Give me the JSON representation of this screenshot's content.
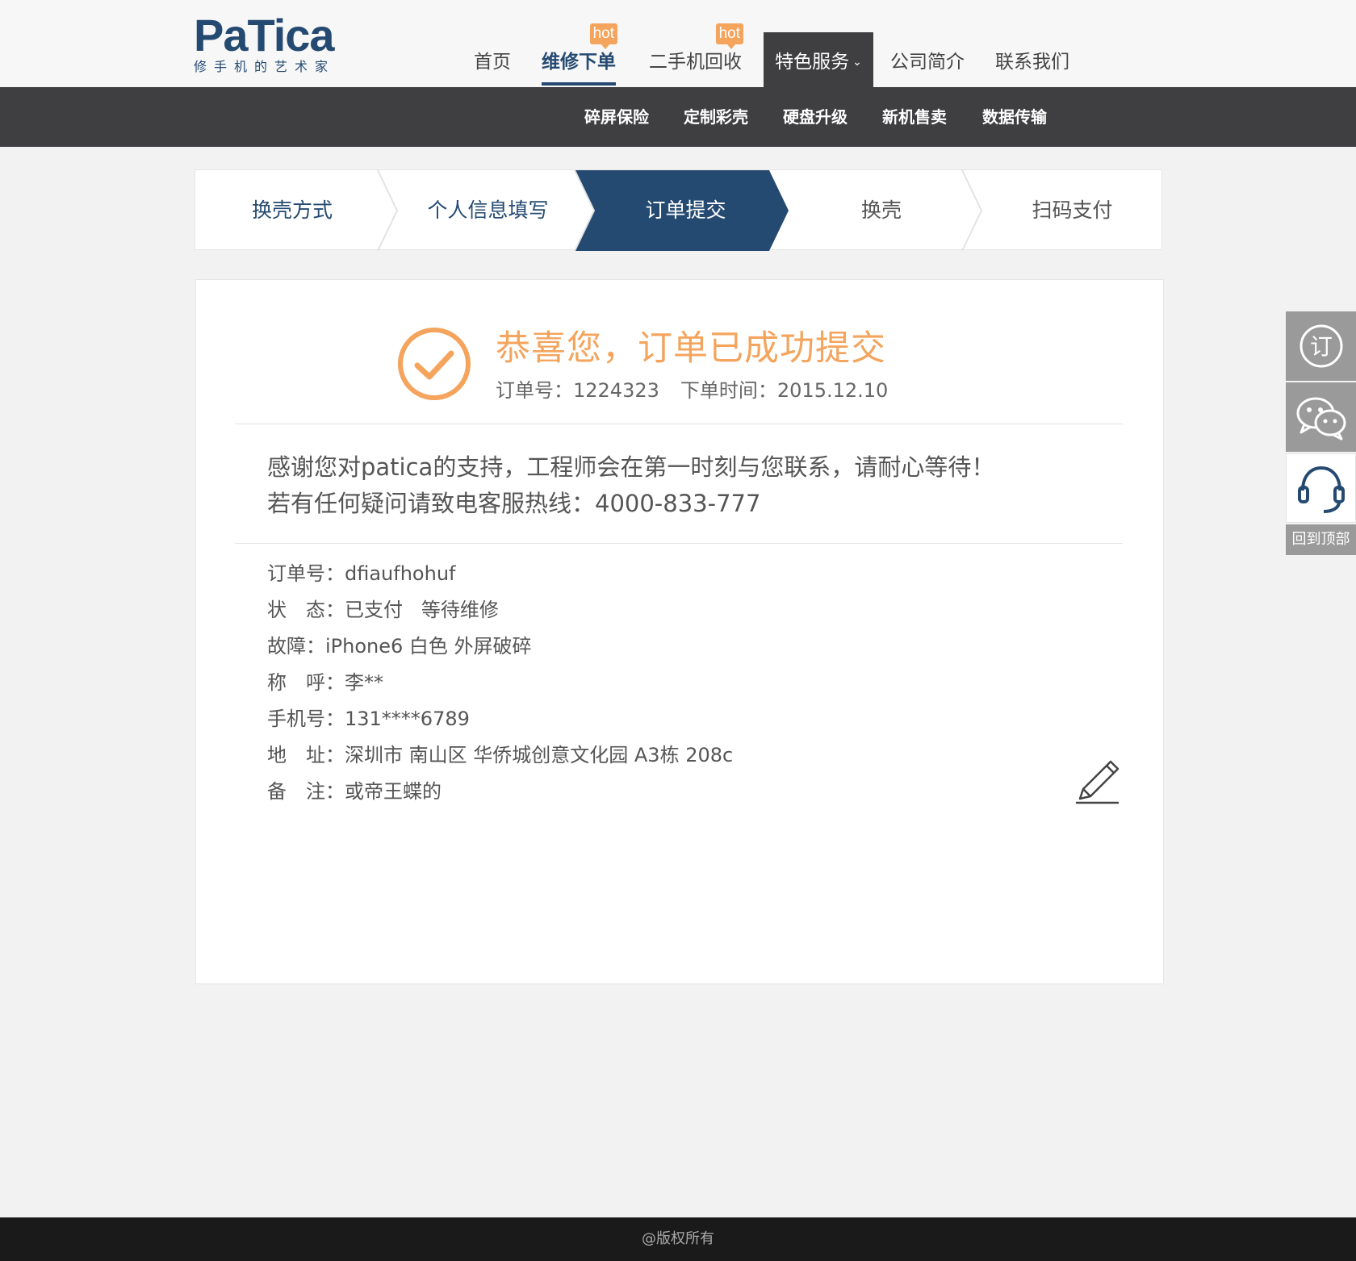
{
  "brand": {
    "name": "PaTica",
    "tagline": "修手机的艺术家"
  },
  "nav": {
    "items": [
      {
        "label": "首页"
      },
      {
        "label": "维修下单",
        "badge": "hot"
      },
      {
        "label": "二手机回收",
        "badge": "hot"
      },
      {
        "label": "特色服务"
      },
      {
        "label": "公司简介"
      },
      {
        "label": "联系我们"
      }
    ],
    "active": "维修下单"
  },
  "subnav": {
    "items": [
      "碎屏保险",
      "定制彩壳",
      "硬盘升级",
      "新机售卖",
      "数据传输"
    ]
  },
  "steps": {
    "items": [
      "换壳方式",
      "个人信息填写",
      "订单提交",
      "换壳",
      "扫码支付"
    ],
    "current": "订单提交"
  },
  "success": {
    "title": "恭喜您，订单已成功提交",
    "order_no": "订单号：1224323",
    "order_time": "下单时间：2015.12.10"
  },
  "message": {
    "line1": "感谢您对patica的支持，工程师会在第一时刻与您联系，请耐心等待！",
    "line2": "若有任何疑问请致电客服热线：4000-833-777"
  },
  "details": [
    {
      "label": "订单号：",
      "value": "dfiaufhohuf"
    },
    {
      "label": "状　态：",
      "value": "已支付   等待维修"
    },
    {
      "label": "故障：",
      "value": "iPhone6 白色 外屏破碎"
    },
    {
      "label": "称　呼：",
      "value": "李**"
    },
    {
      "label": "手机号：",
      "value": "131****6789"
    },
    {
      "label": "地　址：",
      "value": "深圳市 南山区 华侨城创意文化园 A3栋 208c"
    },
    {
      "label": "备　注：",
      "value": "或帝王蝶的"
    }
  ],
  "side": {
    "order_glyph": "订",
    "back_to_top": "回到顶部"
  },
  "footer": {
    "text": "@版权所有"
  },
  "colors": {
    "brand": "#254a72",
    "accent": "#f4a45c",
    "dark_bar": "#3f3f42",
    "footer": "#1a1a1a"
  }
}
